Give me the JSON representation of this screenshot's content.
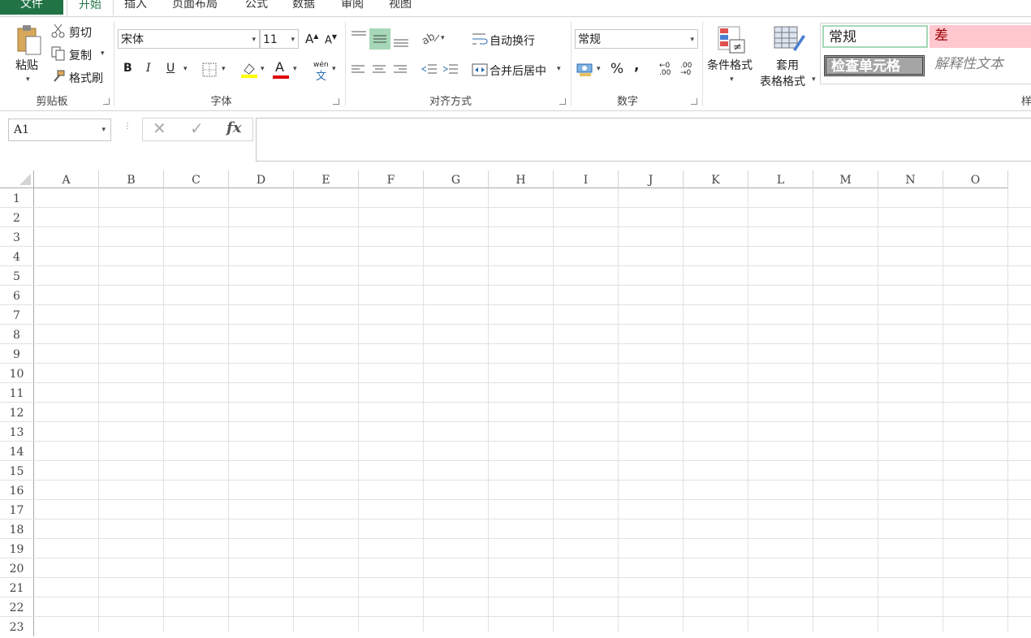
{
  "tabs": [
    "文件",
    "开始",
    "插入",
    "页面布局",
    "公式",
    "数据",
    "审阅",
    "视图"
  ],
  "clipboard": {
    "paste": "粘贴",
    "cut": "剪切",
    "copy": "复制",
    "format_painter": "格式刷",
    "group": "剪贴板"
  },
  "font": {
    "name": "宋体",
    "size": "11",
    "bold": "B",
    "italic": "I",
    "underline": "U",
    "grow": "A",
    "shrink": "A",
    "font_color": "A",
    "phonetic": "wén",
    "phonetic_char": "文",
    "group": "字体"
  },
  "alignment": {
    "wrap": "自动换行",
    "merge": "合并后居中",
    "group": "对齐方式"
  },
  "number": {
    "format": "常规",
    "percent": "%",
    "comma": ",",
    "inc_dec": "←0 .00",
    "dec_dec": ".00 →0",
    "group": "数字"
  },
  "styles": {
    "conditional": "条件格式",
    "table_line1": "套用",
    "table_line2": "表格格式",
    "normal": "常规",
    "bad": "差",
    "check": "检查单元格",
    "explanatory": "解释性文本",
    "group_partial": "样"
  },
  "formula_bar": {
    "name_box": "A1",
    "fx": "fx",
    "cancel": "✕",
    "enter": "✓"
  },
  "columns": [
    "A",
    "B",
    "C",
    "D",
    "E",
    "F",
    "G",
    "H",
    "I",
    "J",
    "K",
    "L",
    "M",
    "N",
    "O"
  ],
  "rows": [
    "1",
    "2",
    "3",
    "4",
    "5",
    "6",
    "7",
    "8",
    "9",
    "10",
    "11",
    "12",
    "13",
    "14",
    "15",
    "16",
    "17",
    "18",
    "19",
    "20",
    "21",
    "22",
    "23"
  ],
  "colors": {
    "accent": "#217346",
    "style_bad_bg": "#ffc7ce",
    "style_bad_text": "#9c0006",
    "check_bg": "#a5a5a5"
  }
}
